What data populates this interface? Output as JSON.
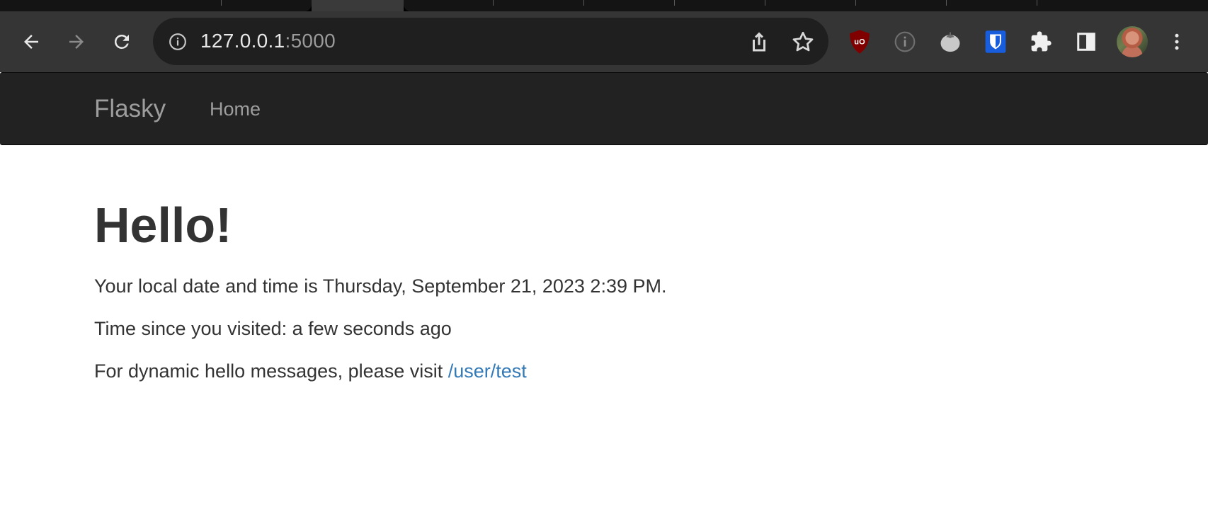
{
  "browser": {
    "url_host": "127.0.0.1",
    "url_port": ":5000",
    "icons": {
      "back": "back-arrow-icon",
      "forward": "forward-arrow-icon",
      "reload": "reload-icon",
      "site_info": "info-icon",
      "share": "share-icon",
      "bookmark": "star-icon",
      "extensions": [
        "ublock-origin-icon",
        "info-circle-extension-icon",
        "tomato-timer-icon",
        "bitwarden-icon",
        "puzzle-extensions-icon",
        "side-panel-icon"
      ],
      "menu": "kebab-menu-icon"
    }
  },
  "navbar": {
    "brand": "Flasky",
    "home": "Home"
  },
  "main": {
    "heading": "Hello!",
    "local_time_text": "Your local date and time is Thursday, September 21, 2023 2:39 PM.",
    "since_text": "Time since you visited: a few seconds ago",
    "dynamic_prefix": "For dynamic hello messages, please visit ",
    "dynamic_link": "/user/test"
  },
  "colors": {
    "navbar_bg": "#222222",
    "navbar_text": "#9d9d9d",
    "body_text": "#333333",
    "link": "#337ab7",
    "toolbar_bg": "#353535",
    "omnibox_bg": "#1f1f1f"
  }
}
